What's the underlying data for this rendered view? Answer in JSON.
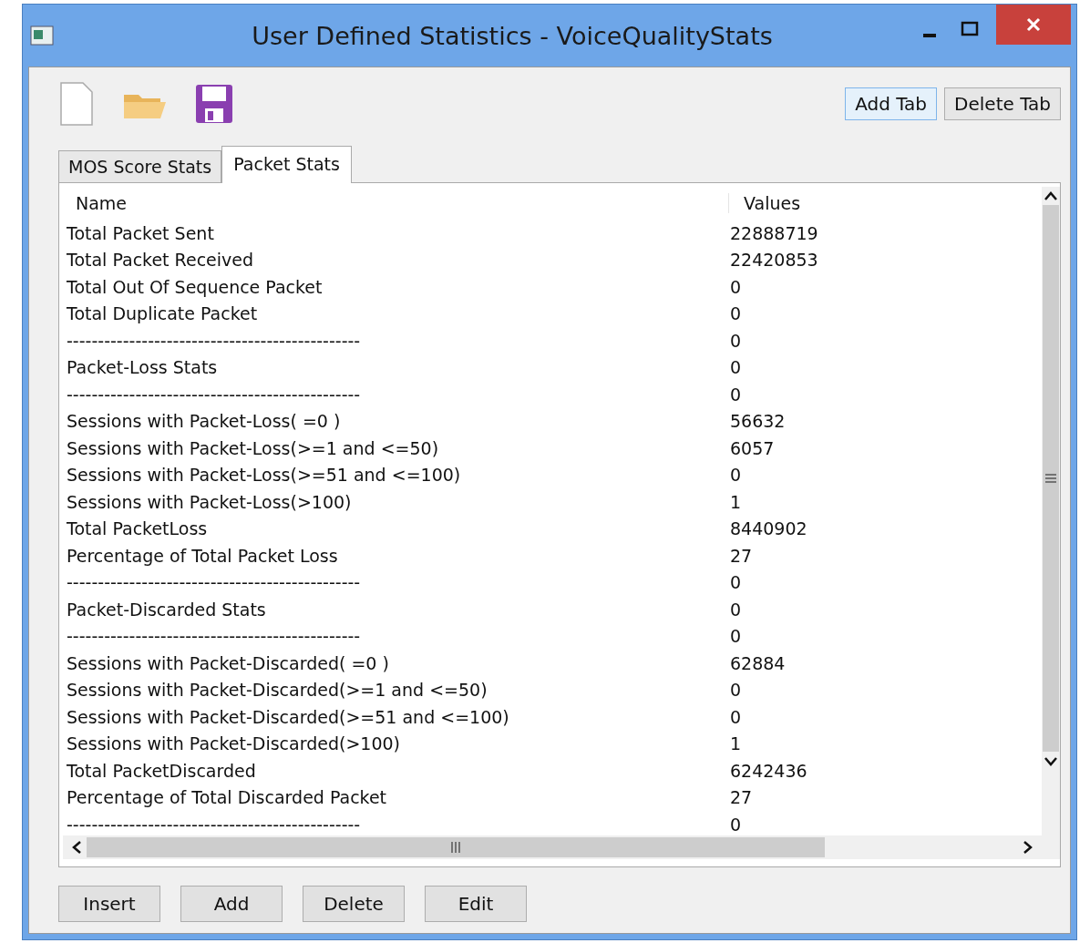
{
  "window": {
    "title": "User Defined Statistics - VoiceQualityStats"
  },
  "toolbar": {
    "buttons": [
      "Add Tab",
      "Delete Tab"
    ]
  },
  "tabs": [
    {
      "label": "MOS Score Stats",
      "selected": false
    },
    {
      "label": "Packet Stats",
      "selected": true
    }
  ],
  "table": {
    "columns": [
      "Name",
      "Values"
    ],
    "rows": [
      {
        "name": "Total Packet Sent",
        "value": "22888719"
      },
      {
        "name": "Total Packet Received",
        "value": "22420853"
      },
      {
        "name": "Total Out Of Sequence Packet",
        "value": "0"
      },
      {
        "name": "Total Duplicate Packet",
        "value": "0"
      },
      {
        "name": "-----------------------------------------------",
        "value": "0"
      },
      {
        "name": "Packet-Loss Stats",
        "value": "0"
      },
      {
        "name": "-----------------------------------------------",
        "value": "0"
      },
      {
        "name": "Sessions with Packet-Loss( =0 )",
        "value": "56632"
      },
      {
        "name": "Sessions with Packet-Loss(>=1 and <=50)",
        "value": "6057"
      },
      {
        "name": "Sessions with Packet-Loss(>=51 and <=100)",
        "value": "0"
      },
      {
        "name": "Sessions with Packet-Loss(>100)",
        "value": "1"
      },
      {
        "name": "Total PacketLoss",
        "value": "8440902"
      },
      {
        "name": "Percentage of Total Packet Loss",
        "value": "27"
      },
      {
        "name": "-----------------------------------------------",
        "value": "0"
      },
      {
        "name": "Packet-Discarded Stats",
        "value": "0"
      },
      {
        "name": "-----------------------------------------------",
        "value": "0"
      },
      {
        "name": "Sessions with Packet-Discarded( =0 )",
        "value": "62884"
      },
      {
        "name": "Sessions with Packet-Discarded(>=1 and <=50)",
        "value": "0"
      },
      {
        "name": "Sessions with Packet-Discarded(>=51 and <=100)",
        "value": "0"
      },
      {
        "name": "Sessions with Packet-Discarded(>100)",
        "value": "1"
      },
      {
        "name": "Total PacketDiscarded",
        "value": "6242436"
      },
      {
        "name": "Percentage of Total Discarded Packet",
        "value": "27"
      },
      {
        "name": "-----------------------------------------------",
        "value": "0"
      }
    ]
  },
  "buttons": [
    "Insert",
    "Add",
    "Delete",
    "Edit"
  ]
}
